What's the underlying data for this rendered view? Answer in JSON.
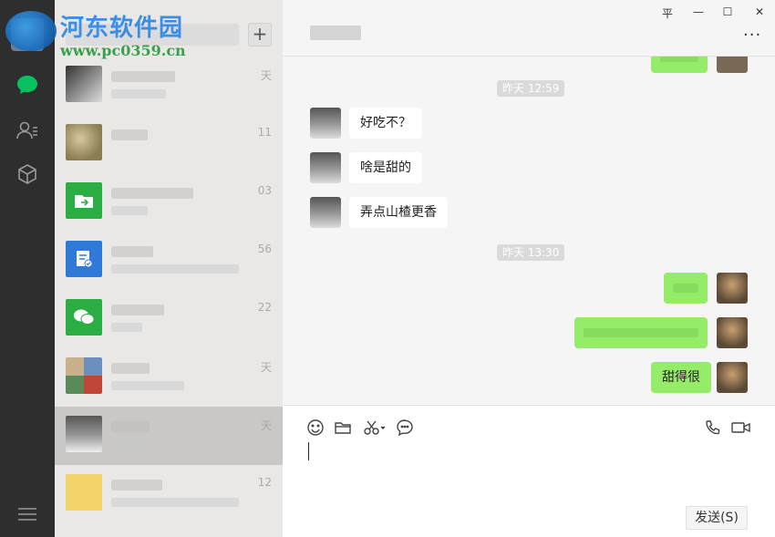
{
  "window": {
    "pin_label": "平",
    "minimize_label": "—",
    "maximize_label": "☐",
    "close_label": "✕",
    "more_label": "···"
  },
  "watermark": {
    "title": "河东软件园",
    "url": "www.pc0359.cn"
  },
  "sidebar": {
    "icons": [
      "chat-icon",
      "contacts-icon",
      "box-icon",
      "menu-icon"
    ],
    "accent": "#07c160"
  },
  "chat_list": {
    "add_label": "+",
    "items": [
      {
        "time": "天"
      },
      {
        "time": "11"
      },
      {
        "time": "03"
      },
      {
        "time": "56"
      },
      {
        "time": "22"
      },
      {
        "time": "天"
      },
      {
        "time": "天"
      },
      {
        "time": "12"
      }
    ]
  },
  "messages": {
    "stamp1": "昨天 12:59",
    "msg1": "好吃不？",
    "msg2": "啥是甜的",
    "msg3": "弄点山楂更香",
    "stamp2": "昨天 13:30",
    "msg6": "甜得很"
  },
  "composer": {
    "send_label": "发送(S)"
  },
  "colors": {
    "out_bubble": "#95ec69",
    "in_bubble": "#ffffff",
    "nav_bg": "#2e2e2e"
  }
}
